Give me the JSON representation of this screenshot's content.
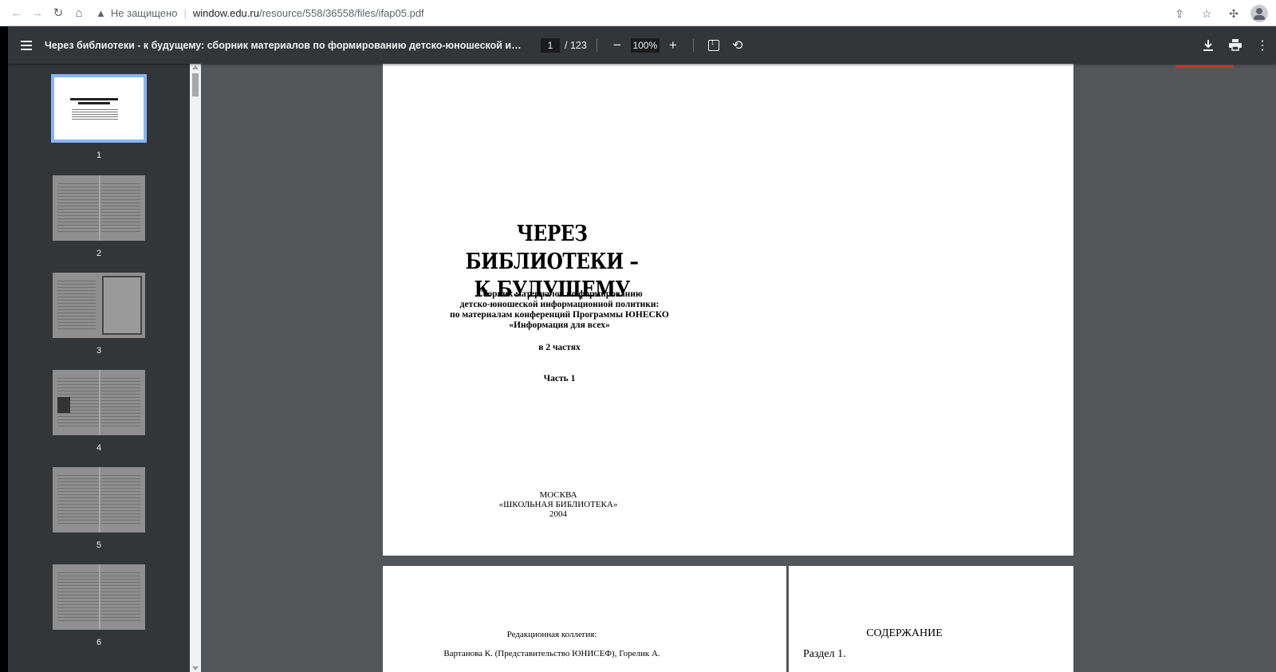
{
  "browser": {
    "security_label": "Не защищено",
    "url_host": "window.edu.ru",
    "url_path": "/resource/558/36558/files/ifap05.pdf"
  },
  "toolbar": {
    "title": "Через библиотеки - к будущему: сборник материалов по формированию детско-юношеской информацион...",
    "current_page": "1",
    "total_pages": "/ 123",
    "zoom": "100%",
    "zoom_out_label": "−",
    "zoom_in_label": "+"
  },
  "thumbnails": [
    {
      "number": "1"
    },
    {
      "number": "2"
    },
    {
      "number": "3"
    },
    {
      "number": "4"
    },
    {
      "number": "5"
    },
    {
      "number": "6"
    }
  ],
  "page1": {
    "title_line1": "ЧЕРЕЗ БИБЛИОТЕКИ –",
    "title_line2": "К БУДУЩЕМУ",
    "subtitle_line1": "Сборник материалов по формированию",
    "subtitle_line2": "детско-юношеской информационной политики:",
    "subtitle_line3": "по материалам конференций Программы ЮНЕСКО",
    "subtitle_line4": "«Информация для всех»",
    "parts": "в 2 частях",
    "part": "Часть 1",
    "city": "МОСКВА",
    "publisher": "«ШКОЛЬНАЯ БИБЛИОТЕКА»",
    "year": "2004"
  },
  "page2": {
    "editorial_heading": "Редакционная коллегия:",
    "editorial_names": "Вартанова К. (Представительство ЮНИСЕФ), Горелик А."
  },
  "page3": {
    "toc_heading": "СОДЕРЖАНИЕ",
    "toc_first": "Раздел 1."
  },
  "colors": {
    "toolbar_bg": "#323639",
    "viewer_bg": "#525659",
    "selected_thumb_border": "#8ab4f8",
    "indicator_red": "#d93025"
  },
  "icons": {
    "back": "arrow-left-icon",
    "forward": "arrow-right-icon",
    "reload": "reload-icon",
    "home": "home-icon",
    "warning": "warning-icon",
    "share": "share-icon",
    "bookmark": "star-icon",
    "extensions": "puzzle-icon",
    "profile": "profile-icon",
    "menu": "hamburger-menu-icon",
    "fit": "fit-to-page-icon",
    "rotate": "rotate-icon",
    "download": "download-icon",
    "print": "print-icon",
    "more": "more-vert-icon"
  }
}
